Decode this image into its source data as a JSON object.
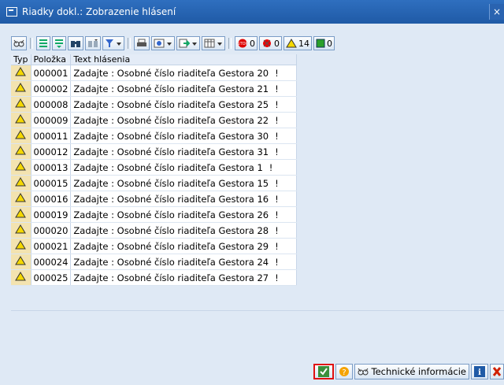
{
  "window": {
    "title": "Riadky dokl.: Zobrazenie hlásení",
    "close_glyph": "×"
  },
  "toolbar": {
    "counters": {
      "stop": "0",
      "error": "0",
      "warning": "14",
      "success": "0"
    },
    "icons": [
      "glasses-icon",
      "sort-ascending-icon",
      "sort-filter-icon",
      "find-icon",
      "find-next-icon",
      "filter-icon",
      "print-icon",
      "export-icon",
      "layout-icon",
      "table-view-icon"
    ]
  },
  "table": {
    "headers": {
      "typ": "Typ",
      "item": "Položka",
      "text": "Text hlásenia"
    },
    "rows": [
      {
        "item": "000001",
        "text": "Zadajte : Osobné číslo riaditeľa Gestora 20",
        "flag": "!"
      },
      {
        "item": "000002",
        "text": "Zadajte : Osobné číslo riaditeľa Gestora 21",
        "flag": "!"
      },
      {
        "item": "000008",
        "text": "Zadajte : Osobné číslo riaditeľa Gestora 25",
        "flag": "!"
      },
      {
        "item": "000009",
        "text": "Zadajte : Osobné číslo riaditeľa Gestora 22",
        "flag": "!"
      },
      {
        "item": "000011",
        "text": "Zadajte : Osobné číslo riaditeľa Gestora 30",
        "flag": "!"
      },
      {
        "item": "000012",
        "text": "Zadajte : Osobné číslo riaditeľa Gestora 31",
        "flag": "!"
      },
      {
        "item": "000013",
        "text": "Zadajte : Osobné číslo riaditeľa Gestora 1",
        "flag": "!"
      },
      {
        "item": "000015",
        "text": "Zadajte : Osobné číslo riaditeľa Gestora 15",
        "flag": "!"
      },
      {
        "item": "000016",
        "text": "Zadajte : Osobné číslo riaditeľa Gestora 16",
        "flag": "!"
      },
      {
        "item": "000019",
        "text": "Zadajte : Osobné číslo riaditeľa Gestora 26",
        "flag": "!"
      },
      {
        "item": "000020",
        "text": "Zadajte : Osobné číslo riaditeľa Gestora 28",
        "flag": "!"
      },
      {
        "item": "000021",
        "text": "Zadajte : Osobné číslo riaditeľa Gestora 29",
        "flag": "!"
      },
      {
        "item": "000024",
        "text": "Zadajte : Osobné číslo riaditeľa Gestora 24",
        "flag": "!"
      },
      {
        "item": "000025",
        "text": "Zadajte : Osobné číslo riaditeľa Gestora 27",
        "flag": "!"
      }
    ]
  },
  "footer": {
    "tech_info_label": "Technické informácie"
  },
  "colors": {
    "title_bg": "#1f5aa6",
    "warning": "#f5d800",
    "error": "#d00000",
    "success": "#2aa02a",
    "ok_highlight": "#e01010"
  }
}
